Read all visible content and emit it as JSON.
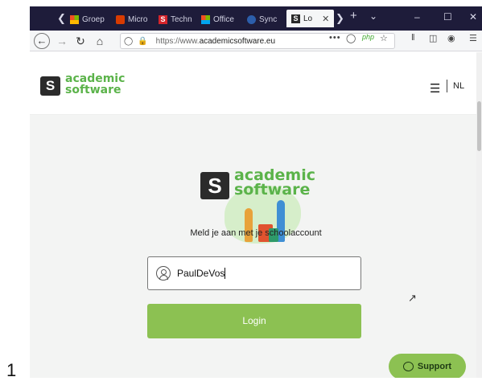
{
  "page_number": "1",
  "browser": {
    "tabs": [
      {
        "label": "Groep",
        "favicon": "teams-icon"
      },
      {
        "label": "Micro",
        "favicon": "office-icon"
      },
      {
        "label": "Techn",
        "favicon": "academicsoftware-icon"
      },
      {
        "label": "Office",
        "favicon": "microsoft-icon"
      },
      {
        "label": "Sync",
        "favicon": "sync-icon"
      },
      {
        "label": "Lo",
        "favicon": "academicsoftware-icon",
        "active": true
      }
    ],
    "url_prefix": "https://www.",
    "url_domain": "academicsoftware.eu",
    "url_suffix": "",
    "php_badge": "php",
    "more_dots": "•••"
  },
  "site": {
    "logo_line1": "academic",
    "logo_line2": "software",
    "logo_mark": "S",
    "lang": "NL"
  },
  "login": {
    "hero_line1": "academic",
    "hero_line2": "software",
    "prompt": "Meld je aan met je schoolaccount",
    "username_value": "PaulDeVos",
    "login_label": "Login"
  },
  "support": {
    "label": "Support"
  },
  "colors": {
    "brand_green": "#8cc152",
    "logo_green": "#5bb34a",
    "tab_strip": "#1e1c3a"
  }
}
